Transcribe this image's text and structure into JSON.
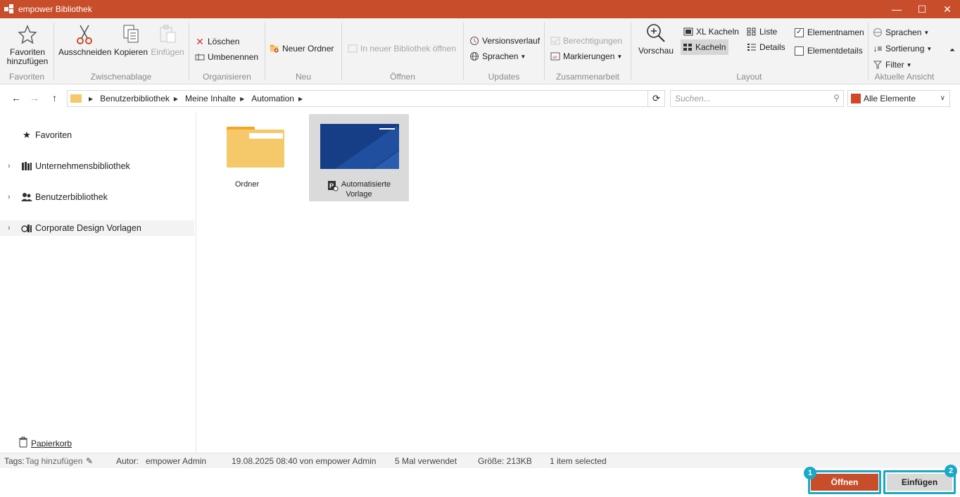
{
  "window": {
    "title": "empower Bibliothek",
    "controls": [
      "—",
      "☐",
      "✕"
    ]
  },
  "ribbon": {
    "favoriten": {
      "button_line1": "Favoriten",
      "button_line2": "hinzufügen",
      "group": "Favoriten"
    },
    "zwischenablage": {
      "cut": "Ausschneiden",
      "copy": "Kopieren",
      "paste": "Einfügen",
      "group": "Zwischenablage"
    },
    "organisieren": {
      "delete": "Löschen",
      "rename": "Umbenennen",
      "group": "Organisieren"
    },
    "neu": {
      "new_folder": "Neuer Ordner",
      "group": "Neu"
    },
    "oeffnen": {
      "open_new_lib": "In neuer Bibliothek öffnen",
      "group": "Öffnen"
    },
    "updates": {
      "history": "Versionsverlauf",
      "languages": "Sprachen",
      "group": "Updates"
    },
    "zusammenarbeit": {
      "permissions": "Berechtigungen",
      "markings": "Markierungen",
      "group": "Zusammenarbeit"
    },
    "layout": {
      "preview": "Vorschau",
      "xl_tiles": "XL Kacheln",
      "tiles": "Kacheln",
      "list": "Liste",
      "details": "Details",
      "element_names": "Elementnamen",
      "element_details": "Elementdetails",
      "group": "Layout"
    },
    "ansicht": {
      "languages": "Sprachen",
      "sort": "Sortierung",
      "filter": "Filter",
      "group": "Aktuelle Ansicht"
    }
  },
  "addressbar": {
    "breadcrumbs": [
      "Benutzerbibliothek",
      "Meine Inhalte",
      "Automation"
    ],
    "search_placeholder": "Suchen...",
    "filter_value": "Alle Elemente"
  },
  "sidebar": {
    "items": [
      {
        "label": "Favoriten"
      },
      {
        "label": "Unternehmensbibliothek"
      },
      {
        "label": "Benutzerbibliothek"
      },
      {
        "label": "Corporate Design Vorlagen"
      }
    ],
    "trash": "Papierkorb"
  },
  "content": {
    "tiles": [
      {
        "label": "Ordner"
      },
      {
        "label_line1": "Automatisierte",
        "label_line2": "Vorlage"
      }
    ]
  },
  "statusbar": {
    "tags_label": "Tags:",
    "tags_value": "Tag hinzufügen",
    "author_label": "Autor:",
    "author_value": "empower Admin",
    "modified": "19.08.2025 08:40 von empower Admin",
    "used": "5 Mal verwendet",
    "size": "Größe: 213KB",
    "selection": "1 item selected"
  },
  "footer": {
    "open_button": "Öffnen",
    "insert_button": "Einfügen",
    "badge1": "1",
    "badge2": "2"
  },
  "colors": {
    "accent": "#c74d2b",
    "highlight": "#19a9c7",
    "folder": "#f5c96a",
    "thumb": "#163e86"
  }
}
